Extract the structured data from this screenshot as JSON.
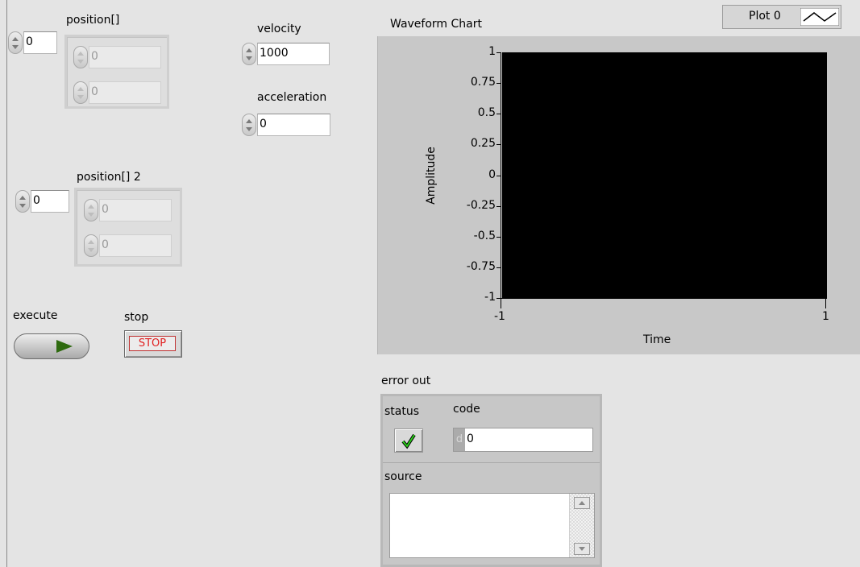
{
  "position": {
    "label": "position[]",
    "index": "0",
    "values": [
      "0",
      "0"
    ]
  },
  "position2": {
    "label": "position[] 2",
    "index": "0",
    "values": [
      "0",
      "0"
    ]
  },
  "velocity": {
    "label": "velocity",
    "value": "1000"
  },
  "acceleration": {
    "label": "acceleration",
    "value": "0"
  },
  "execute": {
    "label": "execute"
  },
  "stop": {
    "label": "stop",
    "button_text": "STOP"
  },
  "error_out": {
    "label": "error out",
    "status_label": "status",
    "code_label": "code",
    "code_value": "0",
    "code_radix": "d",
    "source_label": "source",
    "source_value": "",
    "status_ok": true
  },
  "chart_data": {
    "type": "line",
    "title": "Waveform Chart",
    "xlabel": "Time",
    "ylabel": "Amplitude",
    "ylim": [
      -1,
      1
    ],
    "xlim": [
      -1,
      1
    ],
    "y_ticks": [
      "1",
      "0.75",
      "0.5",
      "0.25",
      "0",
      "-0.25",
      "-0.5",
      "-0.75",
      "-1"
    ],
    "x_ticks": [
      "-1",
      "1"
    ],
    "legend": "top-right",
    "series": [
      {
        "name": "Plot 0",
        "values": []
      }
    ],
    "background": "#000000"
  }
}
